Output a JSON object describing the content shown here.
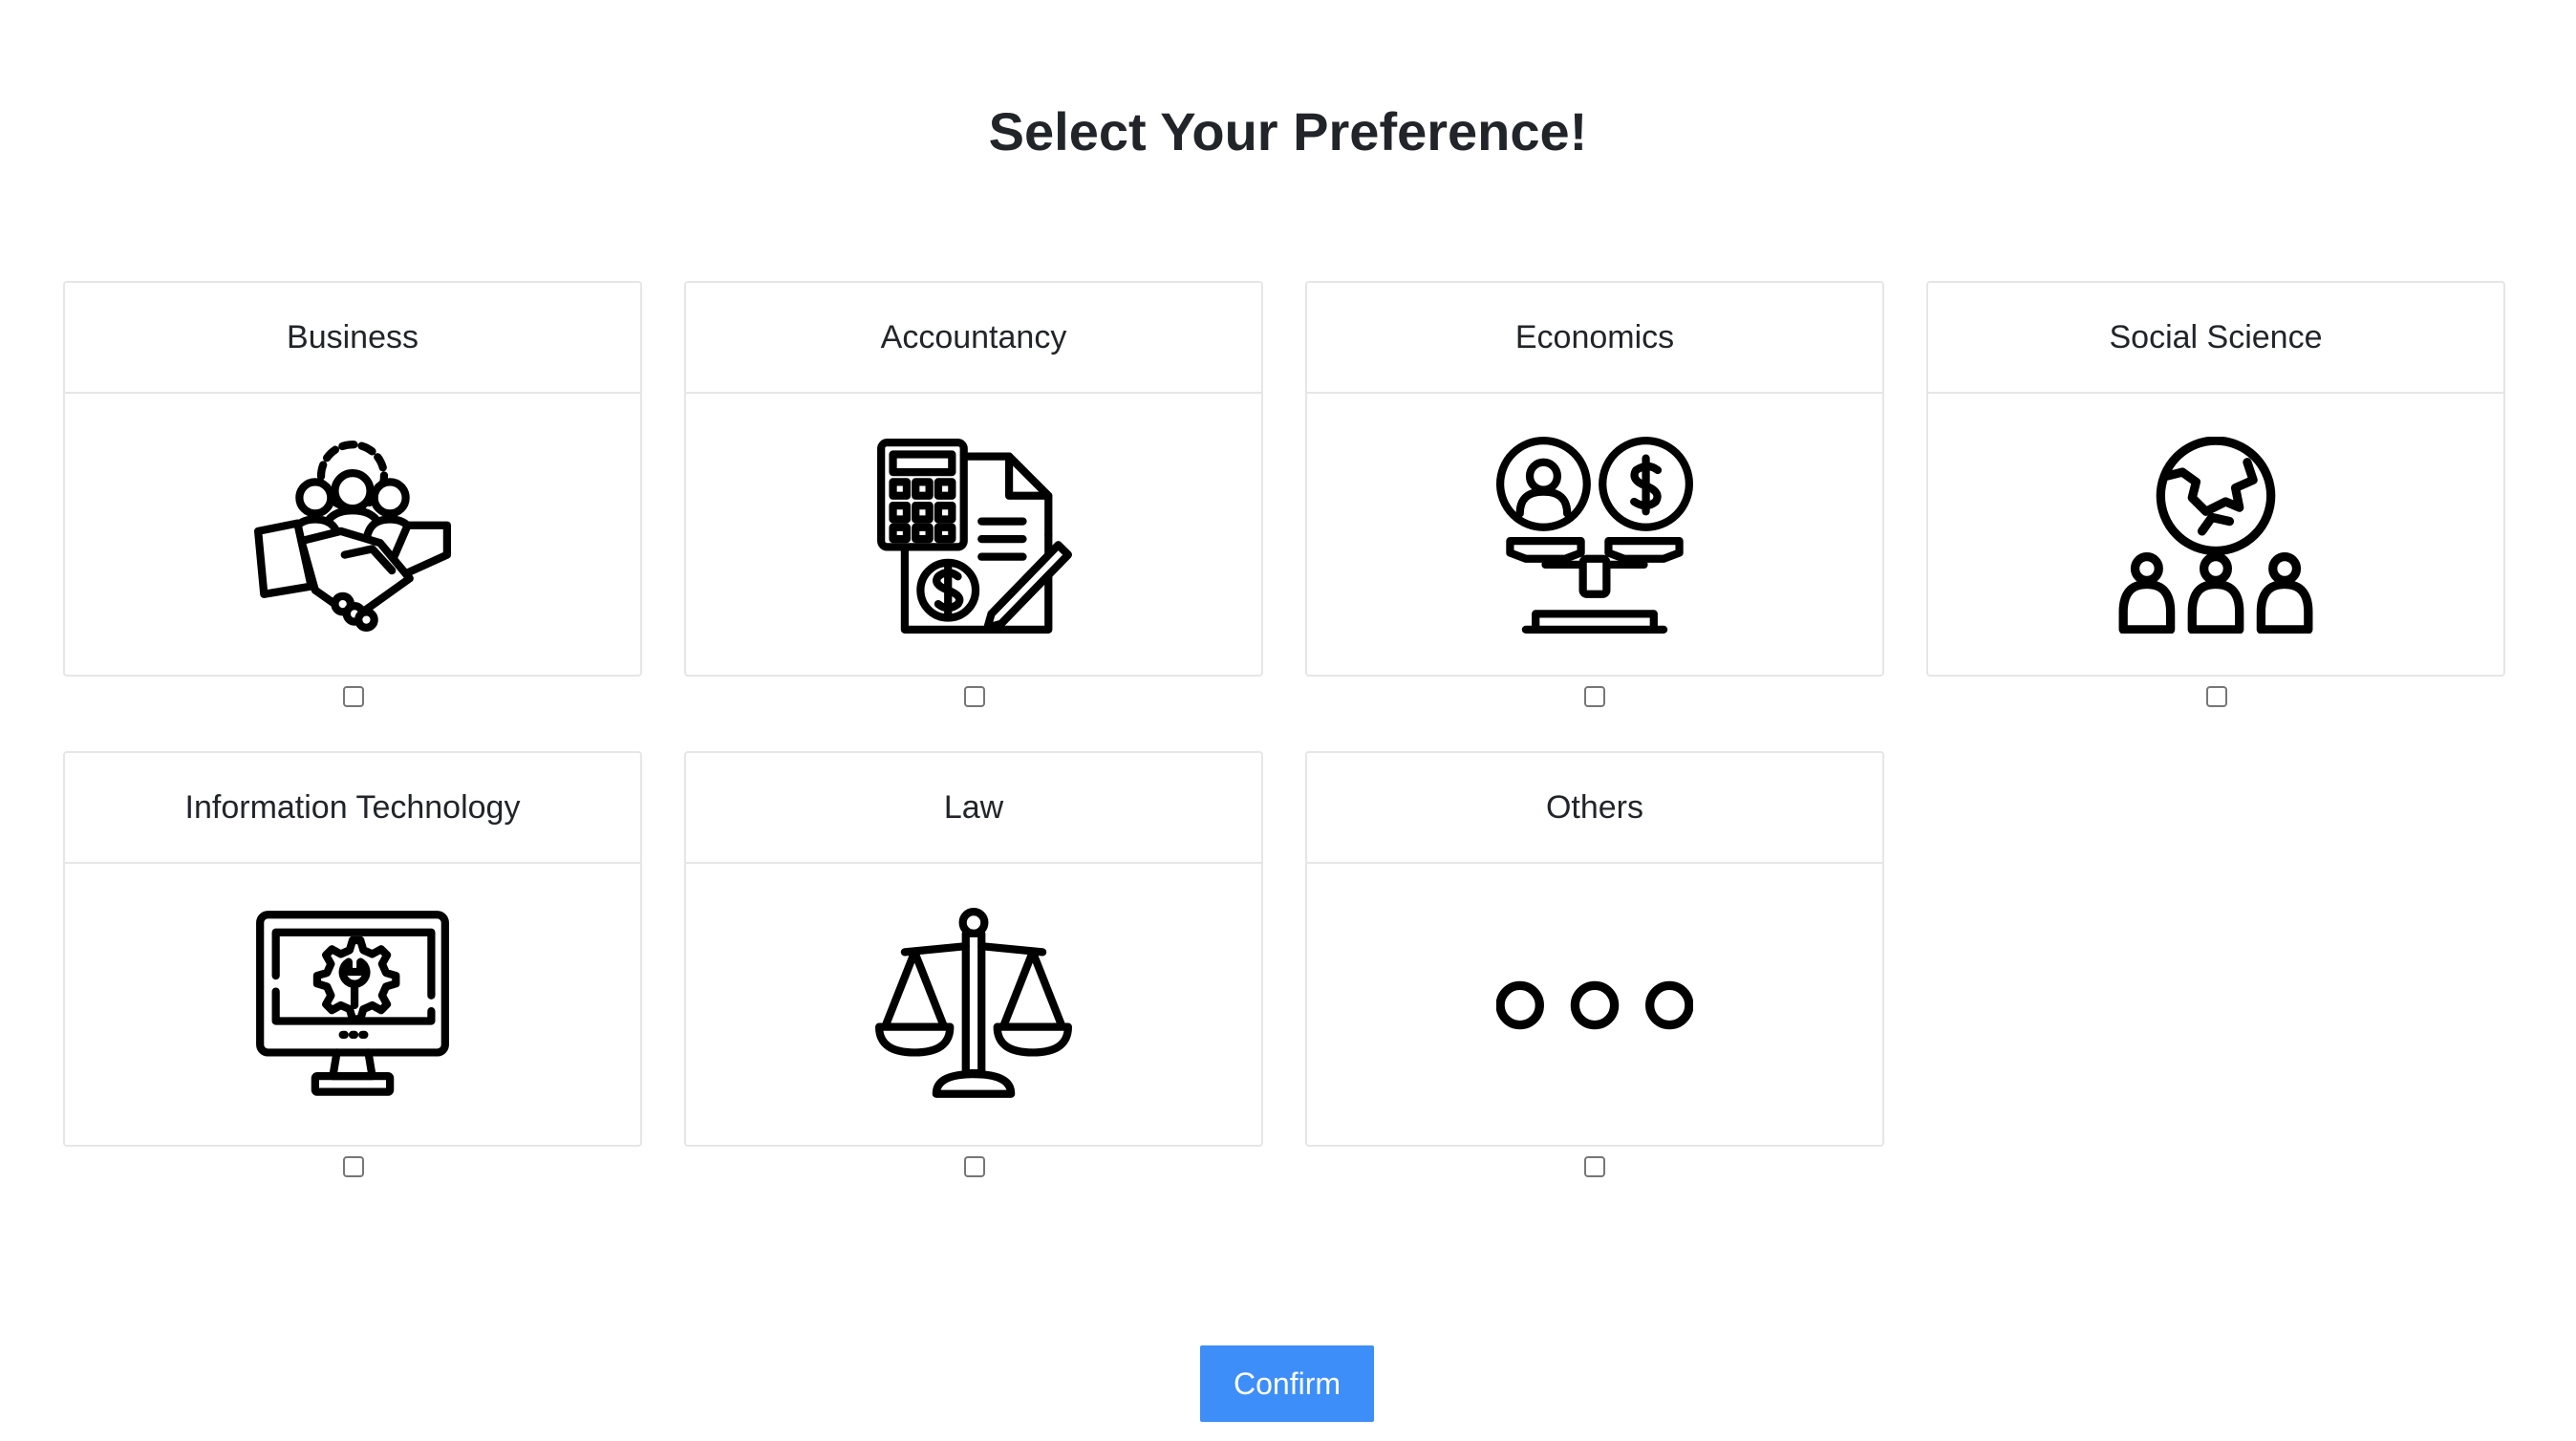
{
  "page": {
    "title": "Select Your Preference!"
  },
  "categories": [
    {
      "label": "Business",
      "icon": "business-handshake-icon",
      "checked": false
    },
    {
      "label": "Accountancy",
      "icon": "accountancy-calculator-icon",
      "checked": false
    },
    {
      "label": "Economics",
      "icon": "economics-scale-icon",
      "checked": false
    },
    {
      "label": "Social Science",
      "icon": "social-science-globe-icon",
      "checked": false
    },
    {
      "label": "Information Technology",
      "icon": "it-monitor-gear-icon",
      "checked": false
    },
    {
      "label": "Law",
      "icon": "law-scales-icon",
      "checked": false
    },
    {
      "label": "Others",
      "icon": "others-ellipsis-icon",
      "checked": false
    }
  ],
  "actions": {
    "confirm_label": "Confirm"
  },
  "colors": {
    "accent": "#3d8ef8",
    "border": "#e6e6e6",
    "text": "#212529"
  }
}
